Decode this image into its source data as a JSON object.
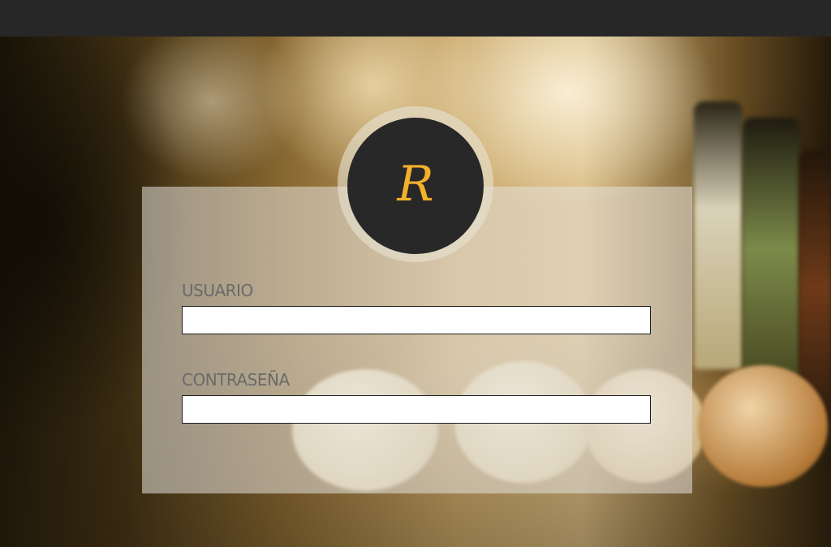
{
  "logo": {
    "letter": "R"
  },
  "form": {
    "username": {
      "label": "USUARIO",
      "value": "",
      "placeholder": ""
    },
    "password": {
      "label": "CONTRASEÑA",
      "value": "",
      "placeholder": ""
    }
  },
  "colors": {
    "topbar": "#272727",
    "logo_background": "#282828",
    "logo_letter": "#f3b02a",
    "label_text": "#6a6a6a"
  }
}
